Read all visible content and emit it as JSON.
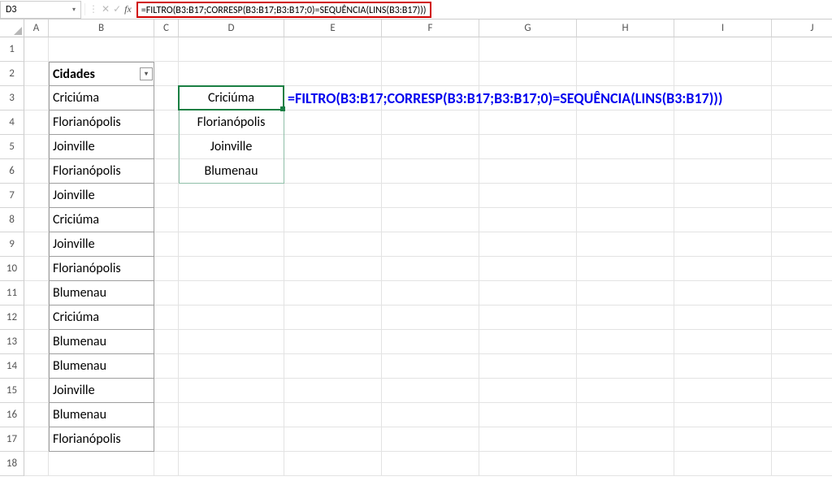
{
  "nameBox": "D3",
  "formulaBar": "=FILTRO(B3:B17;CORRESP(B3:B17;B3:B17;0)=SEQUÊNCIA(LINS(B3:B17)))",
  "columns": [
    "A",
    "B",
    "C",
    "D",
    "E",
    "F",
    "G",
    "H",
    "I",
    "J"
  ],
  "rows": [
    1,
    2,
    3,
    4,
    5,
    6,
    7,
    8,
    9,
    10,
    11,
    12,
    13,
    14,
    15,
    16,
    17,
    18
  ],
  "tableHeader": "Cidades",
  "tableBCells": [
    "Criciúma",
    "Florianópolis",
    "Joinville",
    "Florianópolis",
    "Joinville",
    "Criciúma",
    "Joinville",
    "Florianópolis",
    "Blumenau",
    "Criciúma",
    "Blumenau",
    "Blumenau",
    "Joinville",
    "Blumenau",
    "Florianópolis"
  ],
  "spillD": [
    "Criciúma",
    "Florianópolis",
    "Joinville",
    "Blumenau"
  ],
  "annotation": "=FILTRO(B3:B17;CORRESP(B3:B17;B3:B17;0)=SEQUÊNCIA(LINS(B3:B17)))",
  "activeCell": {
    "col": "D",
    "row": 3
  },
  "chart_data": null
}
